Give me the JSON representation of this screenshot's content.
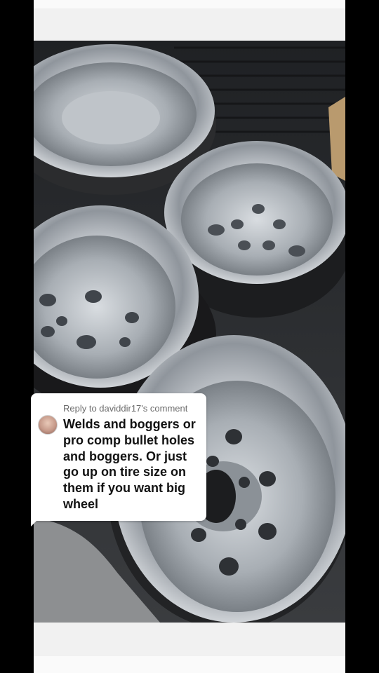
{
  "comment": {
    "reply_to": "Reply to daviddir17's comment",
    "text": "Welds and boggers or pro comp bullet holes and boggers. Or just go up on tire size on them if you want big wheel"
  },
  "photo": {
    "subject": "polished-aluminum-wheels"
  },
  "colors": {
    "letterbox": "#000000",
    "frame": "#f1f1f1",
    "card": "#ffffff",
    "reply_text": "#6b6b6b",
    "comment_text": "#111111"
  }
}
